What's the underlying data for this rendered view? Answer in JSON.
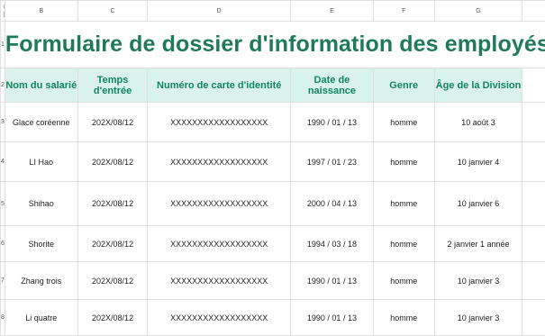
{
  "columns": [
    "B",
    "C",
    "D",
    "E",
    "F",
    "G"
  ],
  "rows": [
    "1",
    "2",
    "3",
    "4",
    "5",
    "6",
    "7",
    "8"
  ],
  "title": "Formulaire de dossier d'information des employés",
  "headers": {
    "name": "Nom du salarié",
    "entry": "Temps d'entrée",
    "id": "Numéro de carte d'identité",
    "birth": "Date de naissance",
    "gender": "Genre",
    "age": "Âge de la Division"
  },
  "records": [
    {
      "name": "Glace coréenne",
      "entry": "202X/08/12",
      "id": "XXXXXXXXXXXXXXXXXX",
      "birth": "1990 / 01 / 13",
      "gender": "homme",
      "age": "10 août 3"
    },
    {
      "name": "LI Hao",
      "entry": "202X/08/12",
      "id": "XXXXXXXXXXXXXXXXXX",
      "birth": "1997 / 01 / 23",
      "gender": "homme",
      "age": "10 janvier 4"
    },
    {
      "name": "Shihao",
      "entry": "202X/08/12",
      "id": "XXXXXXXXXXXXXXXXXX",
      "birth": "2000 / 04 / 13",
      "gender": "homme",
      "age": "10 janvier 6"
    },
    {
      "name": "Shorite",
      "entry": "202X/08/12",
      "id": "XXXXXXXXXXXXXXXXXX",
      "birth": "1994 / 03 / 18",
      "gender": "homme",
      "age": "2 janvier 1 année"
    },
    {
      "name": "Zhang trois",
      "entry": "202X/08/12",
      "id": "XXXXXXXXXXXXXXXXXX",
      "birth": "1990 / 01 / 13",
      "gender": "homme",
      "age": "10 janvier 3"
    },
    {
      "name": "Li quatre",
      "entry": "202X/08/12",
      "id": "XXXXXXXXXXXXXXXXXX",
      "birth": "1990 / 01 / 13",
      "gender": "homme",
      "age": "10 janvier 3"
    }
  ]
}
